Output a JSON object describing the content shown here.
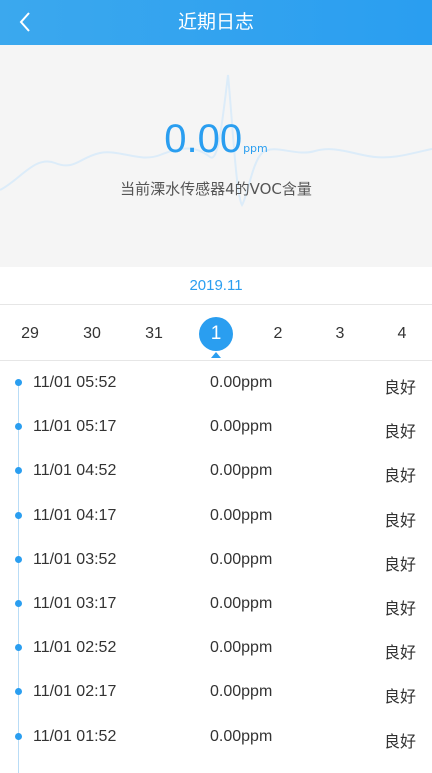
{
  "header": {
    "title": "近期日志",
    "back_icon": "chevron-left-icon"
  },
  "hero": {
    "value": "0.00",
    "unit": "ppm",
    "label": "当前溧水传感器4的VOC含量"
  },
  "month": "2019.11",
  "days": [
    {
      "label": "29",
      "active": false
    },
    {
      "label": "30",
      "active": false
    },
    {
      "label": "31",
      "active": false
    },
    {
      "label": "1",
      "active": true
    },
    {
      "label": "2",
      "active": false
    },
    {
      "label": "3",
      "active": false
    },
    {
      "label": "4",
      "active": false
    }
  ],
  "logs": [
    {
      "time": "11/01 05:52",
      "value": "0.00ppm",
      "status": "良好"
    },
    {
      "time": "11/01 05:17",
      "value": "0.00ppm",
      "status": "良好"
    },
    {
      "time": "11/01 04:52",
      "value": "0.00ppm",
      "status": "良好"
    },
    {
      "time": "11/01 04:17",
      "value": "0.00ppm",
      "status": "良好"
    },
    {
      "time": "11/01 03:52",
      "value": "0.00ppm",
      "status": "良好"
    },
    {
      "time": "11/01 03:17",
      "value": "0.00ppm",
      "status": "良好"
    },
    {
      "time": "11/01 02:52",
      "value": "0.00ppm",
      "status": "良好"
    },
    {
      "time": "11/01 02:17",
      "value": "0.00ppm",
      "status": "良好"
    },
    {
      "time": "11/01 01:52",
      "value": "0.00ppm",
      "status": "良好"
    }
  ],
  "colors": {
    "accent": "#2a9ef0",
    "background": "#f5f5f5",
    "text": "#333333"
  }
}
